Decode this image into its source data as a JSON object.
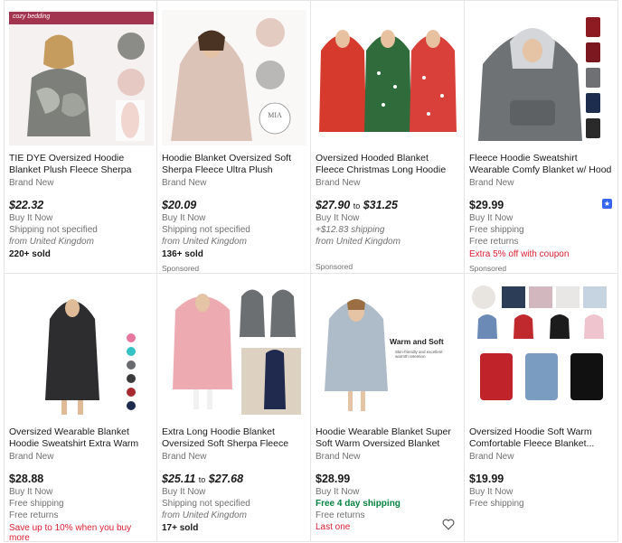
{
  "items": [
    {
      "title": "TIE DYE Oversized Hoodie Blanket Plush Fleece Sherpa Giant Big...",
      "condition": "Brand New",
      "price": "$22.32",
      "lines": [
        "Buy It Now",
        "Shipping not specified"
      ],
      "origin": "from United Kingdom",
      "sold": "220+ sold",
      "image_brand": "cozy bedding"
    },
    {
      "title": "Hoodie Blanket Oversized Soft Sherpa Fleece Ultra Plush Hooded...",
      "condition": "Brand New",
      "price": "$20.09",
      "lines": [
        "Buy It Now",
        "Shipping not specified"
      ],
      "origin": "from United Kingdom",
      "sold": "136+ sold",
      "sponsored": "Sponsored",
      "image_logo": "MIA"
    },
    {
      "title": "Oversized Hooded Blanket Fleece Christmas Long Hoodie Lounge...",
      "condition": "Brand New",
      "price_low": "$27.90",
      "price_to": "to",
      "price_high": "$31.25",
      "lines": [
        "Buy It Now",
        "+$12.83 shipping"
      ],
      "origin": "from United Kingdom",
      "sponsored": "Sponsored"
    },
    {
      "title": "Fleece Hoodie Sweatshirt Wearable Comfy Blanket w/ Hood Sleeves...",
      "condition": "Brand New",
      "price": "$29.99",
      "lines": [
        "Buy It Now",
        "Free shipping",
        "Free returns"
      ],
      "promo": "Extra 5% off with coupon",
      "sponsored": "Sponsored"
    },
    {
      "title": "Oversized Wearable Blanket Hoodie Sweatshirt Extra Warm Long With...",
      "condition": "Brand New",
      "price": "$28.88",
      "lines": [
        "Buy It Now",
        "Free shipping",
        "Free returns"
      ],
      "promo": "Save up to 10% when you buy more"
    },
    {
      "title": "Extra Long Hoodie Blanket Oversized Soft Sherpa Fleece Gia...",
      "condition": "Brand New",
      "price_low": "$25.11",
      "price_to": "to",
      "price_high": "$27.68",
      "lines": [
        "Buy It Now",
        "Shipping not specified"
      ],
      "origin": "from United Kingdom",
      "sold": "17+ sold"
    },
    {
      "title": "Hoodie Wearable Blanket Super Soft Warm Oversized Blanket Hoodie...",
      "condition": "Brand New",
      "price": "$28.99",
      "lines": [
        "Buy It Now"
      ],
      "fast_shipping": "Free 4 day shipping",
      "returns": "Free returns",
      "last": "Last one",
      "image_caption": "Warm and Soft",
      "image_subcaption": "Skin-friendly and excellent warmth retention"
    },
    {
      "title": "Oversized Hoodie Soft Warm Comfortable Fleece Blanket...",
      "condition": "Brand New",
      "price": "$19.99",
      "lines": [
        "Buy It Now",
        "Free shipping"
      ]
    }
  ]
}
